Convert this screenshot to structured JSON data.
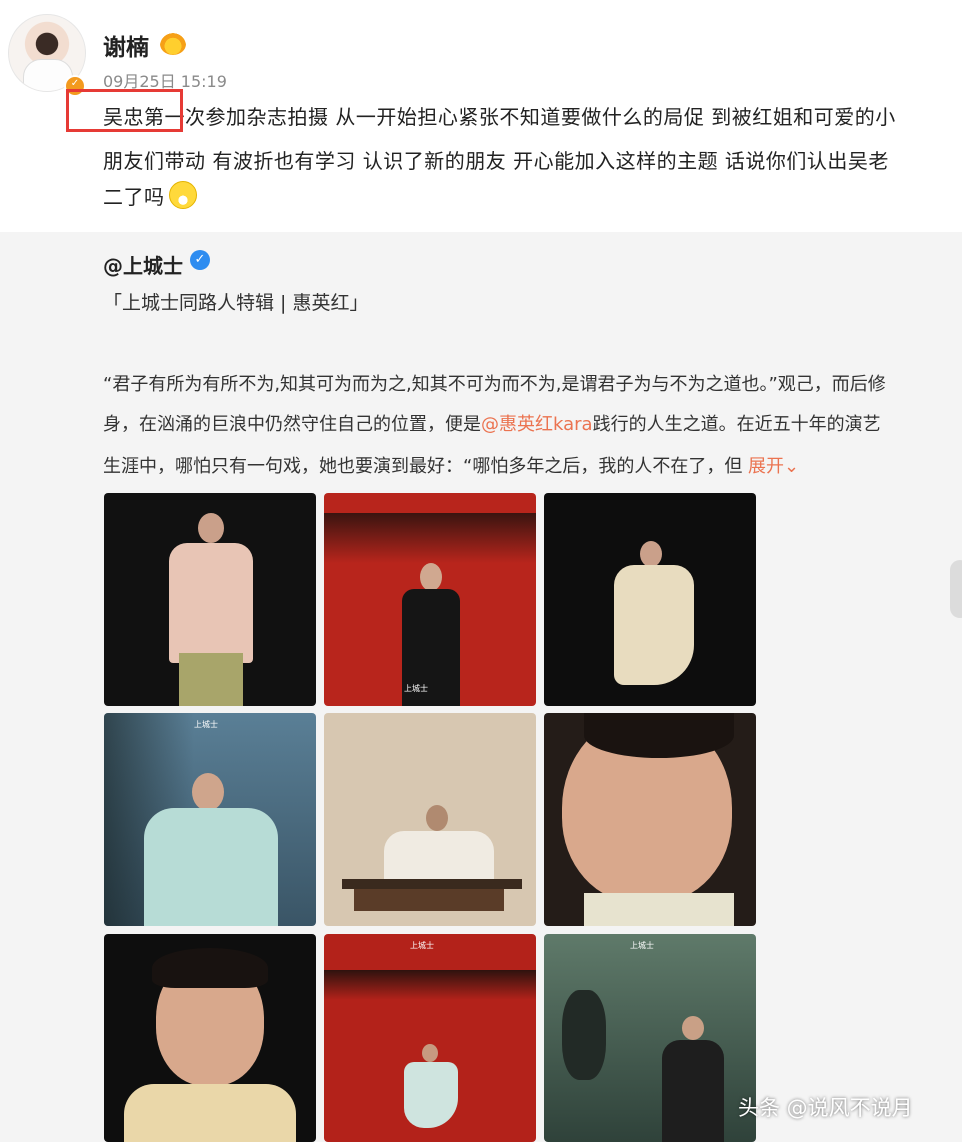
{
  "post": {
    "username": "谢楠",
    "avatar_icon": "avatar-woman-icon",
    "verified_icon": "verified-badge-icon",
    "crown_icon": "crown-icon",
    "timestamp": "09月25日 15:19",
    "text_lines": [
      "吴忠第一次参加杂志拍摄 从一开始担心紧张不知道要做什么的局促 到被红姐和可爱的小",
      "朋友们带动 有波折也有学习 认识了新的朋友 开心能加入这样的主题 话说你们认出吴老",
      "二了吗"
    ],
    "emoji_icon": "grinning-emoji-icon",
    "highlight_color": "#e63a35"
  },
  "repost": {
    "username": "@上城士",
    "verified_icon": "blue-verified-icon",
    "title": "「上城士同路人特辑 | 惠英红」",
    "body_lines": [
      "“君子有所为有所不为,知其可为而为之,知其不可为而不为,是谓君子为与不为之道也。”观己，而后修",
      "身，在汹涌的巨浪中仍然守住自己的位置，便是",
      "践行的人生之道。在近五十年的演艺",
      "生涯中，哪怕只有一句戏，她也要演到最好：“哪怕多年之后，我的人不在了，但 "
    ],
    "mention": "@惠英红kara",
    "expand_label": "展开",
    "photos": [
      {
        "name": "photo-child-pink-jacket"
      },
      {
        "name": "photo-woman-red-room"
      },
      {
        "name": "photo-woman-white-dress"
      },
      {
        "name": "photo-child-pine-tree"
      },
      {
        "name": "photo-woman-guqin"
      },
      {
        "name": "photo-child-closeup"
      },
      {
        "name": "photo-child-portrait"
      },
      {
        "name": "photo-child-red-stage"
      },
      {
        "name": "photo-child-rock-garden"
      }
    ],
    "photo_logo": "上城士"
  },
  "watermark": "头条 @说风不说月",
  "colors": {
    "link": "#eb7350",
    "badge_blue": "#2d8cf0",
    "badge_orange": "#f39a1e"
  }
}
